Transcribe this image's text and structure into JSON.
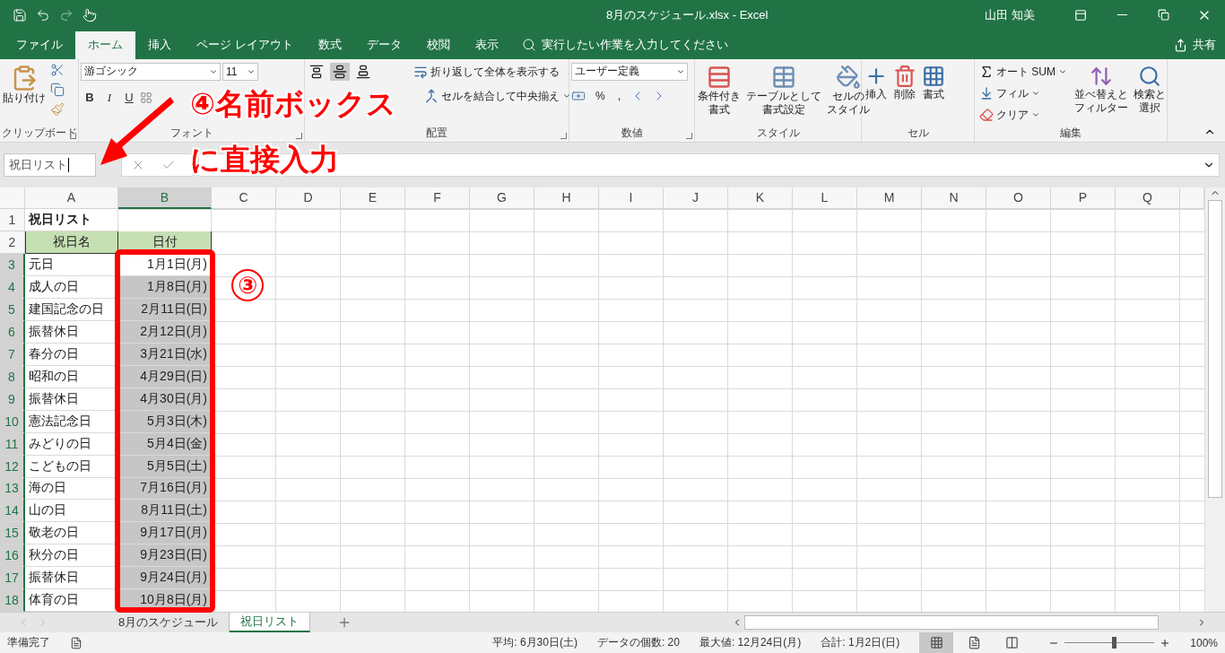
{
  "title_bar": {
    "title": "8月のスケジュール.xlsx  -  Excel",
    "user": "山田 知美"
  },
  "menu_tabs": [
    {
      "label": "ファイル",
      "selected": false
    },
    {
      "label": "ホーム",
      "selected": true
    },
    {
      "label": "挿入",
      "selected": false
    },
    {
      "label": "ページ レイアウト",
      "selected": false
    },
    {
      "label": "数式",
      "selected": false
    },
    {
      "label": "データ",
      "selected": false
    },
    {
      "label": "校閲",
      "selected": false
    },
    {
      "label": "表示",
      "selected": false
    }
  ],
  "tell_me": {
    "placeholder": "実行したい作業を入力してください"
  },
  "share": "共有",
  "ribbon": {
    "clipboard": {
      "paste": "貼り付け",
      "label": "クリップボード"
    },
    "font": {
      "font_name": "游ゴシック",
      "font_size": "11",
      "styles": [
        "B",
        "I",
        "U"
      ],
      "label": "フォント"
    },
    "alignment": {
      "valign": [
        {
          "selected": false
        },
        {
          "selected": true
        },
        {
          "selected": false
        }
      ],
      "wrap": "折り返して全体を表示する",
      "merge": "セルを結合して中央揃え",
      "label": "配置"
    },
    "number": {
      "format": "ユーザー定義",
      "percent": "%",
      "comma": ",",
      "label": "数値"
    },
    "styles": {
      "buttons": [
        {
          "lines": [
            "条件付き",
            "書式"
          ]
        },
        {
          "lines": [
            "テーブルとして",
            "書式設定"
          ]
        },
        {
          "lines": [
            "セルの",
            "スタイル"
          ]
        }
      ],
      "label": "スタイル"
    },
    "cells": {
      "buttons": [
        "挿入",
        "削除",
        "書式"
      ],
      "label": "セル"
    },
    "editing": {
      "autosum": "オート SUM",
      "fill": "フィル",
      "clear": "クリア",
      "sort": [
        "並べ替えと",
        "フィルター"
      ],
      "find": [
        "検索と",
        "選択"
      ],
      "label": "編集"
    }
  },
  "name_box": {
    "value": "祝日リスト"
  },
  "columns": [
    {
      "label": "A",
      "selected": false
    },
    {
      "label": "B",
      "selected": true
    },
    {
      "label": "C",
      "selected": false
    },
    {
      "label": "D",
      "selected": false
    },
    {
      "label": "E",
      "selected": false
    },
    {
      "label": "F",
      "selected": false
    },
    {
      "label": "G",
      "selected": false
    },
    {
      "label": "H",
      "selected": false
    },
    {
      "label": "I",
      "selected": false
    },
    {
      "label": "J",
      "selected": false
    },
    {
      "label": "K",
      "selected": false
    },
    {
      "label": "L",
      "selected": false
    },
    {
      "label": "M",
      "selected": false
    },
    {
      "label": "N",
      "selected": false
    },
    {
      "label": "O",
      "selected": false
    },
    {
      "label": "P",
      "selected": false
    },
    {
      "label": "Q",
      "selected": false
    }
  ],
  "rows": [
    {
      "number": "1",
      "kind": "title",
      "name": "祝日リスト",
      "selected": false
    },
    {
      "number": "2",
      "kind": "header",
      "name": "祝日名",
      "date": "日付",
      "selected": false
    },
    {
      "number": "3",
      "kind": "data",
      "name": "元日",
      "date": "1月1日(月)",
      "selected": true,
      "active": true
    },
    {
      "number": "4",
      "kind": "data",
      "name": "成人の日",
      "date": "1月8日(月)",
      "selected": true,
      "active": false
    },
    {
      "number": "5",
      "kind": "data",
      "name": "建国記念の日",
      "date": "2月11日(日)",
      "selected": true,
      "active": false
    },
    {
      "number": "6",
      "kind": "data",
      "name": "振替休日",
      "date": "2月12日(月)",
      "selected": true,
      "active": false
    },
    {
      "number": "7",
      "kind": "data",
      "name": "春分の日",
      "date": "3月21日(水)",
      "selected": true,
      "active": false
    },
    {
      "number": "8",
      "kind": "data",
      "name": "昭和の日",
      "date": "4月29日(日)",
      "selected": true,
      "active": false
    },
    {
      "number": "9",
      "kind": "data",
      "name": "振替休日",
      "date": "4月30日(月)",
      "selected": true,
      "active": false
    },
    {
      "number": "10",
      "kind": "data",
      "name": "憲法記念日",
      "date": "5月3日(木)",
      "selected": true,
      "active": false
    },
    {
      "number": "11",
      "kind": "data",
      "name": "みどりの日",
      "date": "5月4日(金)",
      "selected": true,
      "active": false
    },
    {
      "number": "12",
      "kind": "data",
      "name": "こどもの日",
      "date": "5月5日(土)",
      "selected": true,
      "active": false
    },
    {
      "number": "13",
      "kind": "data",
      "name": "海の日",
      "date": "7月16日(月)",
      "selected": true,
      "active": false
    },
    {
      "number": "14",
      "kind": "data",
      "name": "山の日",
      "date": "8月11日(土)",
      "selected": true,
      "active": false
    },
    {
      "number": "15",
      "kind": "data",
      "name": "敬老の日",
      "date": "9月17日(月)",
      "selected": true,
      "active": false
    },
    {
      "number": "16",
      "kind": "data",
      "name": "秋分の日",
      "date": "9月23日(日)",
      "selected": true,
      "active": false
    },
    {
      "number": "17",
      "kind": "data",
      "name": "振替休日",
      "date": "9月24日(月)",
      "selected": true,
      "active": false
    },
    {
      "number": "18",
      "kind": "data",
      "name": "体育の日",
      "date": "10月8日(月)",
      "selected": true,
      "active": false
    }
  ],
  "sheet_tabs": [
    {
      "label": "8月のスケジュール",
      "selected": false
    },
    {
      "label": "祝日リスト",
      "selected": true
    }
  ],
  "status_bar": {
    "ready": "準備完了",
    "average": "平均: 6月30日(土)",
    "count": "データの個数: 20",
    "max": "最大値: 12月24日(月)",
    "sum": "合計: 1月2日(日)",
    "views": [
      {
        "kind": "normal",
        "selected": true
      },
      {
        "kind": "page_layout",
        "selected": false
      },
      {
        "kind": "page_break",
        "selected": false
      }
    ],
    "zoom": {
      "text": "100%",
      "level": 0.55
    }
  },
  "annotations": [
    {
      "kind": "callout",
      "lines": [
        "④名前ボックス",
        "に直接入力"
      ]
    },
    {
      "kind": "marker",
      "text": "③"
    }
  ]
}
